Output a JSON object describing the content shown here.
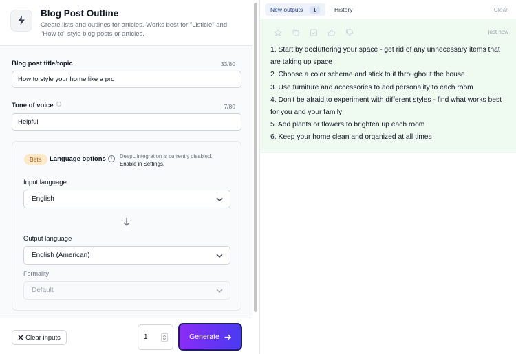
{
  "tool": {
    "title": "Blog Post Outline",
    "description": "Create lists and outlines for articles. Works best for \"Listicle\" and \"How to\" style blog posts or articles.",
    "icon": "lightning-icon"
  },
  "fields": {
    "topic": {
      "label": "Blog post title/topic",
      "count": "33/80",
      "value": "How to style your home like a pro"
    },
    "tone": {
      "label": "Tone of voice",
      "count": "7/80",
      "value": "Helpful"
    }
  },
  "language": {
    "badge": "Beta",
    "title": "Language options",
    "note": "DeepL integration is currently disabled.",
    "note_link": "Enable in Settings.",
    "input_label": "Input language",
    "input_value": "English",
    "output_label": "Output language",
    "output_value": "English (American)",
    "formality_label": "Formality",
    "formality_value": "Default"
  },
  "footer": {
    "clear_label": "Clear inputs",
    "quantity": "1",
    "generate_label": "Generate"
  },
  "output_panel": {
    "tab_new": "New outputs",
    "tab_new_count": "1",
    "tab_history": "History",
    "clear": "Clear",
    "timestamp": "just now",
    "lines": [
      "1. Start by decluttering your space - get rid of any unnecessary items that are taking up space",
      "2. Choose a color scheme and stick to it throughout the house",
      "3. Use furniture and accessories to add personality to each room",
      "4. Don't be afraid to experiment with different styles - find what works best for you and your family",
      "5. Add plants or flowers to brighten up each room",
      "6. Keep your home clean and organized at all times"
    ]
  },
  "colors": {
    "accent_start": "#8b2cf5",
    "accent_end": "#4a3af0",
    "output_bg": "#effbf1",
    "beta_bg": "#fde9c8"
  }
}
